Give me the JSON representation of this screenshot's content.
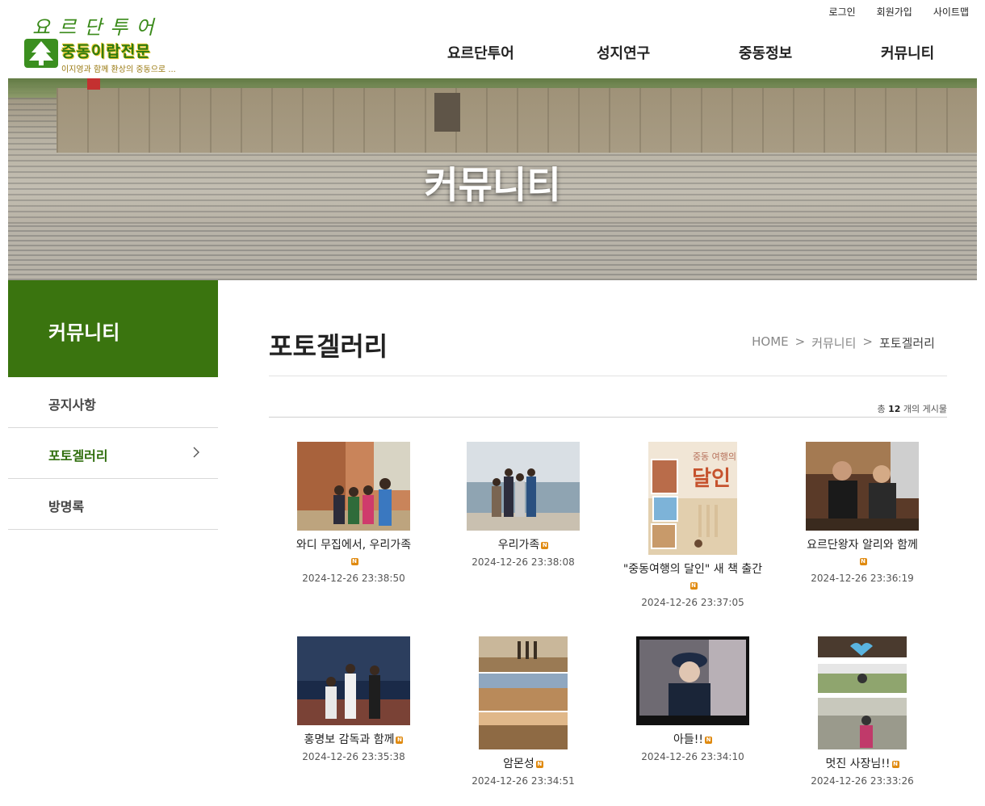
{
  "logo": {
    "top_text": "요르단투어",
    "main_text": "중동이랍전문",
    "sub_text": "이지영과 함께 환상의 중동으로 ..."
  },
  "util_nav": [
    "로그인",
    "회원가입",
    "사이트맵"
  ],
  "gnb": [
    "요르단투어",
    "성지연구",
    "중동정보",
    "커뮤니티"
  ],
  "banner": {
    "title": "커뮤니티"
  },
  "sidebar": {
    "title": "커뮤니티",
    "items": [
      {
        "label": "공지사항",
        "active": false
      },
      {
        "label": "포토겔러리",
        "active": true
      },
      {
        "label": "방명록",
        "active": false
      }
    ]
  },
  "page": {
    "title": "포토겔러리",
    "breadcrumb": [
      "HOME",
      "커뮤니티",
      "포토겔러리"
    ],
    "breadcrumb_sep": ">",
    "total_prefix": "총",
    "total_count": "12",
    "total_suffix": "개의 게시물"
  },
  "new_badge": "N",
  "gallery": [
    {
      "title": "와디 무집에서, 우리가족",
      "date": "2024-12-26 23:38:50",
      "thumb": "family-canyon"
    },
    {
      "title": "우리가족",
      "date": "2024-12-26 23:38:08",
      "thumb": "family-sea"
    },
    {
      "title": "\"중동여행의 달인\" 새 책 출간",
      "date": "2024-12-26 23:37:05",
      "thumb": "book-cover"
    },
    {
      "title": "요르단왕자 알리와 함께",
      "date": "2024-12-26 23:36:19",
      "thumb": "prince-ali"
    },
    {
      "title": "홍명보 감독과 함께",
      "date": "2024-12-26 23:35:38",
      "thumb": "coach-hong"
    },
    {
      "title": "암몬성",
      "date": "2024-12-26 23:34:51",
      "thumb": "amman-citadel"
    },
    {
      "title": "아들!!",
      "date": "2024-12-26 23:34:10",
      "thumb": "son"
    },
    {
      "title": "멋진 사장님!!",
      "date": "2024-12-26 23:33:26",
      "thumb": "boss"
    }
  ],
  "book_cover_text": {
    "top": "중동 여행의",
    "big": "달인"
  },
  "colors": {
    "accent": "#3a740f",
    "badge": "#e08a10"
  }
}
